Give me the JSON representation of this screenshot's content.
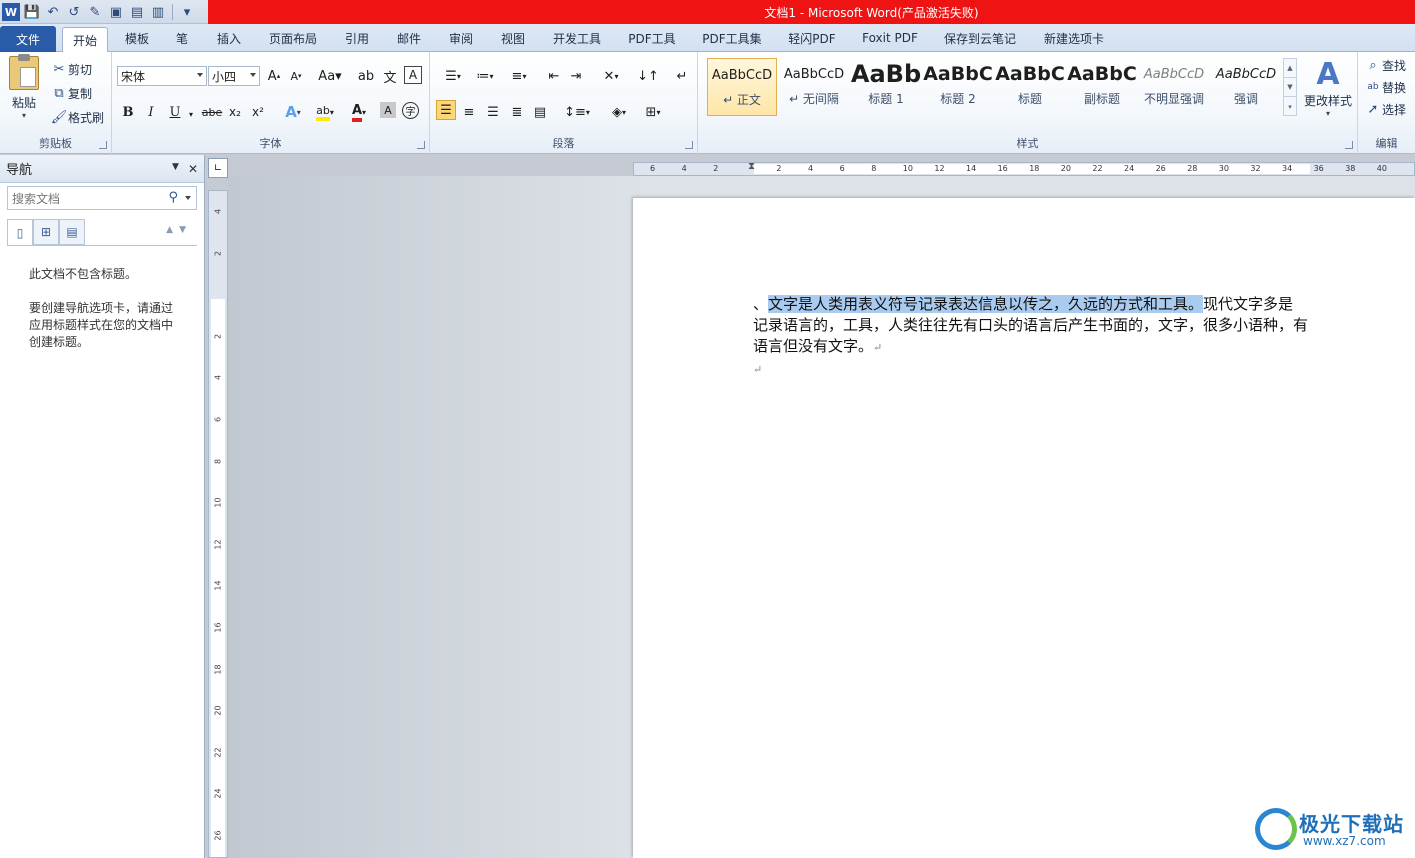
{
  "window": {
    "title": "文档1 - Microsoft Word(产品激活失败)"
  },
  "colors": {
    "title_bar": "#ef1313",
    "file_tab": "#2a5ba8",
    "selection": "#a9cbef"
  },
  "quick_access": [
    {
      "name": "word-app-icon",
      "glyph": "W"
    },
    {
      "name": "save-icon",
      "glyph": "💾"
    },
    {
      "name": "undo-icon",
      "glyph": "↶"
    },
    {
      "name": "redo-icon",
      "glyph": "↺"
    },
    {
      "name": "new-doc-icon",
      "glyph": "✎"
    },
    {
      "name": "print-preview-icon",
      "glyph": "▣"
    },
    {
      "name": "open-icon",
      "glyph": "▤"
    },
    {
      "name": "read-mode-icon",
      "glyph": "▥"
    },
    {
      "name": "customize-qat-icon",
      "glyph": "▾"
    }
  ],
  "tabs": [
    "文件",
    "开始",
    "模板",
    "笔",
    "插入",
    "页面布局",
    "引用",
    "邮件",
    "审阅",
    "视图",
    "开发工具",
    "PDF工具",
    "PDF工具集",
    "轻闪PDF",
    "Foxit PDF",
    "保存到云笔记",
    "新建选项卡"
  ],
  "clipboard": {
    "label": "剪贴板",
    "paste": "粘贴",
    "cut": "剪切",
    "copy": "复制",
    "format_painter": "格式刷"
  },
  "font": {
    "label": "字体",
    "family": "宋体",
    "size": "小四",
    "buttons": [
      "B",
      "I",
      "U",
      "abe",
      "x₂",
      "x²"
    ]
  },
  "paragraph": {
    "label": "段落"
  },
  "styles": {
    "label": "样式",
    "items": [
      {
        "sample": "AaBbCcD",
        "name": "↵ 正文"
      },
      {
        "sample": "AaBbCcD",
        "name": "↵ 无间隔"
      },
      {
        "sample": "AaBb",
        "name": "标题 1"
      },
      {
        "sample": "AaBbC",
        "name": "标题 2"
      },
      {
        "sample": "AaBbC",
        "name": "标题"
      },
      {
        "sample": "AaBbC",
        "name": "副标题"
      },
      {
        "sample": "AaBbCcD",
        "name": "不明显强调"
      },
      {
        "sample": "AaBbCcD",
        "name": "强调"
      }
    ],
    "change_styles": "更改样式"
  },
  "editing": {
    "label": "编辑",
    "find": "查找",
    "replace": "替换",
    "select": "选择"
  },
  "nav_pane": {
    "title": "导航",
    "search_placeholder": "搜索文档",
    "msg1": "此文档不包含标题。",
    "msg2": "要创建导航选项卡，请通过应用标题样式在您的文档中创建标题。"
  },
  "document": {
    "lead": "、",
    "selected": "文字是人类用表义符号记录表达信息以传之，久远的方式和工具。",
    "rest": "现代文字多是记录语言的，工具，人类往往先有口头的语言后产生书面的，文字，很多小语种，有语言但没有文字。"
  },
  "ruler": {
    "h": [
      "6",
      "4",
      "2",
      "",
      "2",
      "4",
      "6",
      "8",
      "10",
      "12",
      "14",
      "16",
      "18",
      "20",
      "22",
      "24",
      "26",
      "28",
      "30",
      "32",
      "34",
      "36",
      "38",
      "40"
    ],
    "v": [
      "4",
      "2",
      "",
      "2",
      "4",
      "6",
      "8",
      "10",
      "12",
      "14",
      "16",
      "18",
      "20",
      "22",
      "24",
      "26"
    ]
  },
  "watermark": {
    "brand": "极光下载站",
    "url": "www.xz7.com"
  }
}
